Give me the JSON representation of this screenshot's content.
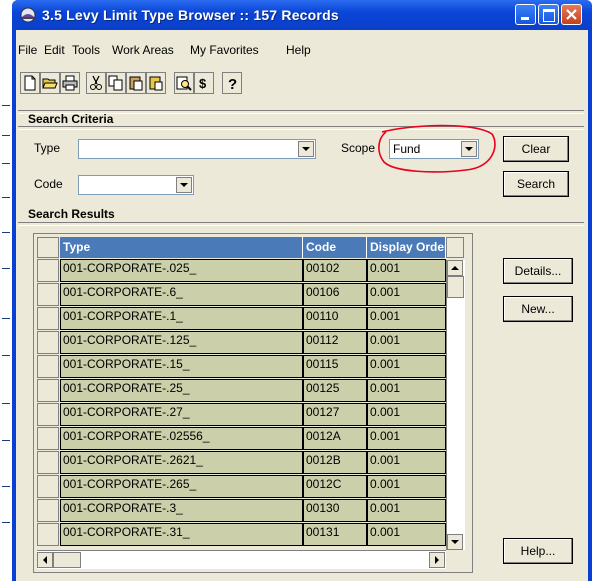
{
  "window": {
    "title": "3.5 Levy Limit Type Browser :: 157 Records",
    "minimize_label": "_",
    "maximize_label": "□",
    "close_label": "X"
  },
  "menu": [
    "File",
    "Edit",
    "Tools",
    "Work Areas",
    "My Favorites",
    "Help"
  ],
  "toolbar_icons": [
    "new-icon",
    "open-icon",
    "print-icon",
    "cut-icon",
    "copy-icon",
    "paste-icon",
    "paste-special-icon",
    "find-icon",
    "currency-icon",
    "help-icon"
  ],
  "search_criteria": {
    "title": "Search Criteria",
    "type_label": "Type",
    "type_value": "",
    "scope_label": "Scope",
    "scope_value": "Fund",
    "code_label": "Code",
    "code_value": "",
    "clear_label": "Clear",
    "search_label": "Search"
  },
  "search_results": {
    "title": "Search Results",
    "columns": [
      "Type",
      "Code",
      "Display Order"
    ],
    "rows": [
      [
        "001-CORPORATE-.025_",
        "00102",
        "0.001"
      ],
      [
        "001-CORPORATE-.6_",
        "00106",
        "0.001"
      ],
      [
        "001-CORPORATE-.1_",
        "00110",
        "0.001"
      ],
      [
        "001-CORPORATE-.125_",
        "00112",
        "0.001"
      ],
      [
        "001-CORPORATE-.15_",
        "00115",
        "0.001"
      ],
      [
        "001-CORPORATE-.25_",
        "00125",
        "0.001"
      ],
      [
        "001-CORPORATE-.27_",
        "00127",
        "0.001"
      ],
      [
        "001-CORPORATE-.02556_",
        "0012A",
        "0.001"
      ],
      [
        "001-CORPORATE-.2621_",
        "0012B",
        "0.001"
      ],
      [
        "001-CORPORATE-.265_",
        "0012C",
        "0.001"
      ],
      [
        "001-CORPORATE-.3_",
        "00130",
        "0.001"
      ],
      [
        "001-CORPORATE-.31_",
        "00131",
        "0.001"
      ]
    ]
  },
  "actions": {
    "details_label": "Details...",
    "new_label": "New...",
    "help_label": "Help..."
  },
  "colors": {
    "title_bar": "#0a46d8",
    "header_bg": "#4a7ab8",
    "cell_bg": "#ccd0aa",
    "annotation": "#e8001c"
  }
}
